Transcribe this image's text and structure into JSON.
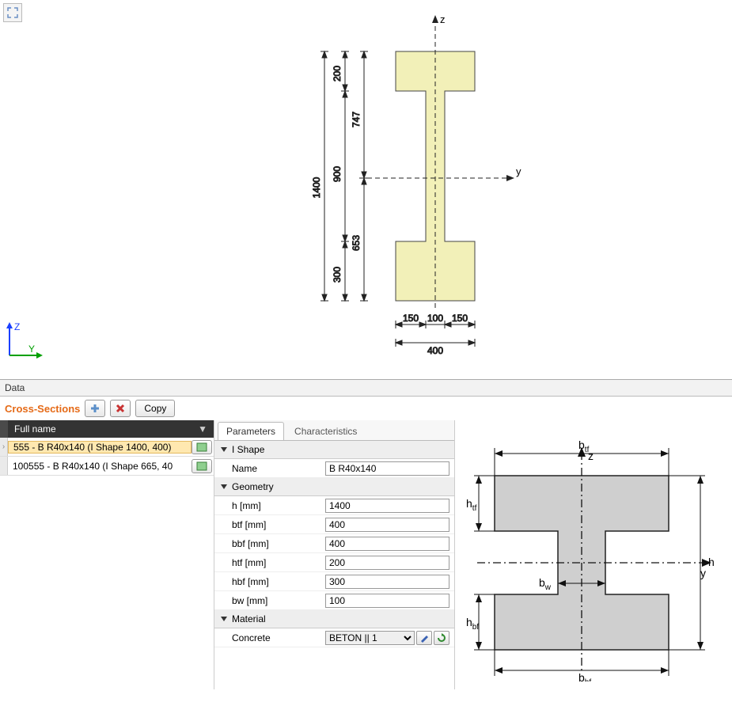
{
  "topAxes": {
    "zLabel": "Z",
    "yLabel": "Y"
  },
  "sectionPreview": {
    "zLabel": "z",
    "yLabel": "y",
    "heightTotal": "1400",
    "heightTop": "200",
    "heightMidUpper": "747",
    "heightMid": "900",
    "heightMidLower": "653",
    "heightBottom": "300",
    "bottomLeft": "150",
    "bottomMid": "100",
    "bottomRight": "150",
    "totalWidth": "400"
  },
  "panel": {
    "dataLabel": "Data",
    "sectionsLabel": "Cross-Sections",
    "copyLabel": "Copy",
    "fullNameHeader": "Full name",
    "rows": [
      {
        "selected": true,
        "label": "555 - B R40x140 (I Shape 1400, 400)"
      },
      {
        "selected": false,
        "label": "100555 - B R40x140 (I Shape 665, 40"
      }
    ]
  },
  "tabs": {
    "parameters": "Parameters",
    "characteristics": "Characteristics"
  },
  "groups": {
    "iShape": "I Shape",
    "geometry": "Geometry",
    "material": "Material"
  },
  "props": {
    "nameKey": "Name",
    "nameVal": "B R40x140",
    "hKey": "h [mm]",
    "hVal": "1400",
    "btfKey": "btf [mm]",
    "btfVal": "400",
    "bbfKey": "bbf [mm]",
    "bbfVal": "400",
    "htfKey": "htf [mm]",
    "htfVal": "200",
    "hbfKey": "hbf [mm]",
    "hbfVal": "300",
    "bwKey": "bw [mm]",
    "bwVal": "100",
    "concreteKey": "Concrete",
    "concreteVal": "BETON || 1"
  },
  "schematic": {
    "btf": "b",
    "btfSub": "tf",
    "bbf": "b",
    "bbfSub": "bf",
    "htf": "h",
    "htfSub": "tf",
    "hbf": "h",
    "hbfSub": "bf",
    "bw": "b",
    "bwSub": "w",
    "h": "h",
    "z": "z",
    "y": "y"
  }
}
